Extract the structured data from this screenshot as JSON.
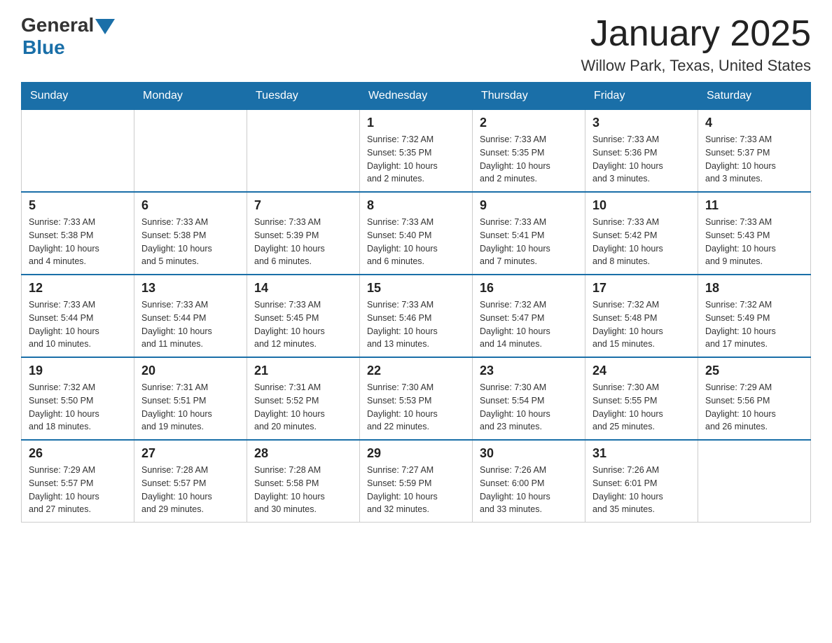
{
  "header": {
    "logo_general": "General",
    "logo_blue": "Blue",
    "title": "January 2025",
    "subtitle": "Willow Park, Texas, United States"
  },
  "days_of_week": [
    "Sunday",
    "Monday",
    "Tuesday",
    "Wednesday",
    "Thursday",
    "Friday",
    "Saturday"
  ],
  "weeks": [
    [
      {
        "day": "",
        "info": ""
      },
      {
        "day": "",
        "info": ""
      },
      {
        "day": "",
        "info": ""
      },
      {
        "day": "1",
        "info": "Sunrise: 7:32 AM\nSunset: 5:35 PM\nDaylight: 10 hours\nand 2 minutes."
      },
      {
        "day": "2",
        "info": "Sunrise: 7:33 AM\nSunset: 5:35 PM\nDaylight: 10 hours\nand 2 minutes."
      },
      {
        "day": "3",
        "info": "Sunrise: 7:33 AM\nSunset: 5:36 PM\nDaylight: 10 hours\nand 3 minutes."
      },
      {
        "day": "4",
        "info": "Sunrise: 7:33 AM\nSunset: 5:37 PM\nDaylight: 10 hours\nand 3 minutes."
      }
    ],
    [
      {
        "day": "5",
        "info": "Sunrise: 7:33 AM\nSunset: 5:38 PM\nDaylight: 10 hours\nand 4 minutes."
      },
      {
        "day": "6",
        "info": "Sunrise: 7:33 AM\nSunset: 5:38 PM\nDaylight: 10 hours\nand 5 minutes."
      },
      {
        "day": "7",
        "info": "Sunrise: 7:33 AM\nSunset: 5:39 PM\nDaylight: 10 hours\nand 6 minutes."
      },
      {
        "day": "8",
        "info": "Sunrise: 7:33 AM\nSunset: 5:40 PM\nDaylight: 10 hours\nand 6 minutes."
      },
      {
        "day": "9",
        "info": "Sunrise: 7:33 AM\nSunset: 5:41 PM\nDaylight: 10 hours\nand 7 minutes."
      },
      {
        "day": "10",
        "info": "Sunrise: 7:33 AM\nSunset: 5:42 PM\nDaylight: 10 hours\nand 8 minutes."
      },
      {
        "day": "11",
        "info": "Sunrise: 7:33 AM\nSunset: 5:43 PM\nDaylight: 10 hours\nand 9 minutes."
      }
    ],
    [
      {
        "day": "12",
        "info": "Sunrise: 7:33 AM\nSunset: 5:44 PM\nDaylight: 10 hours\nand 10 minutes."
      },
      {
        "day": "13",
        "info": "Sunrise: 7:33 AM\nSunset: 5:44 PM\nDaylight: 10 hours\nand 11 minutes."
      },
      {
        "day": "14",
        "info": "Sunrise: 7:33 AM\nSunset: 5:45 PM\nDaylight: 10 hours\nand 12 minutes."
      },
      {
        "day": "15",
        "info": "Sunrise: 7:33 AM\nSunset: 5:46 PM\nDaylight: 10 hours\nand 13 minutes."
      },
      {
        "day": "16",
        "info": "Sunrise: 7:32 AM\nSunset: 5:47 PM\nDaylight: 10 hours\nand 14 minutes."
      },
      {
        "day": "17",
        "info": "Sunrise: 7:32 AM\nSunset: 5:48 PM\nDaylight: 10 hours\nand 15 minutes."
      },
      {
        "day": "18",
        "info": "Sunrise: 7:32 AM\nSunset: 5:49 PM\nDaylight: 10 hours\nand 17 minutes."
      }
    ],
    [
      {
        "day": "19",
        "info": "Sunrise: 7:32 AM\nSunset: 5:50 PM\nDaylight: 10 hours\nand 18 minutes."
      },
      {
        "day": "20",
        "info": "Sunrise: 7:31 AM\nSunset: 5:51 PM\nDaylight: 10 hours\nand 19 minutes."
      },
      {
        "day": "21",
        "info": "Sunrise: 7:31 AM\nSunset: 5:52 PM\nDaylight: 10 hours\nand 20 minutes."
      },
      {
        "day": "22",
        "info": "Sunrise: 7:30 AM\nSunset: 5:53 PM\nDaylight: 10 hours\nand 22 minutes."
      },
      {
        "day": "23",
        "info": "Sunrise: 7:30 AM\nSunset: 5:54 PM\nDaylight: 10 hours\nand 23 minutes."
      },
      {
        "day": "24",
        "info": "Sunrise: 7:30 AM\nSunset: 5:55 PM\nDaylight: 10 hours\nand 25 minutes."
      },
      {
        "day": "25",
        "info": "Sunrise: 7:29 AM\nSunset: 5:56 PM\nDaylight: 10 hours\nand 26 minutes."
      }
    ],
    [
      {
        "day": "26",
        "info": "Sunrise: 7:29 AM\nSunset: 5:57 PM\nDaylight: 10 hours\nand 27 minutes."
      },
      {
        "day": "27",
        "info": "Sunrise: 7:28 AM\nSunset: 5:57 PM\nDaylight: 10 hours\nand 29 minutes."
      },
      {
        "day": "28",
        "info": "Sunrise: 7:28 AM\nSunset: 5:58 PM\nDaylight: 10 hours\nand 30 minutes."
      },
      {
        "day": "29",
        "info": "Sunrise: 7:27 AM\nSunset: 5:59 PM\nDaylight: 10 hours\nand 32 minutes."
      },
      {
        "day": "30",
        "info": "Sunrise: 7:26 AM\nSunset: 6:00 PM\nDaylight: 10 hours\nand 33 minutes."
      },
      {
        "day": "31",
        "info": "Sunrise: 7:26 AM\nSunset: 6:01 PM\nDaylight: 10 hours\nand 35 minutes."
      },
      {
        "day": "",
        "info": ""
      }
    ]
  ]
}
